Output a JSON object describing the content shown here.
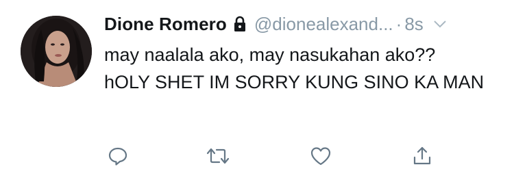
{
  "tweet": {
    "display_name": "Dione Romero",
    "handle": "@dionealexand...",
    "separator": "·",
    "timestamp": "8s",
    "text": "may naalala ako, may nasukahan ako??\nhOLY SHET IM SORRY KUNG SINO KA MAN",
    "protected": true
  },
  "icons": {
    "avatar": "profile-photo",
    "lock": "lock-icon",
    "caret": "chevron-down-icon",
    "reply": "reply-icon",
    "retweet": "retweet-icon",
    "like": "heart-icon",
    "share": "share-icon"
  },
  "colors": {
    "primary_text": "#14171a",
    "secondary_text": "#8899a6",
    "icon": "#657786",
    "background": "#ffffff"
  }
}
